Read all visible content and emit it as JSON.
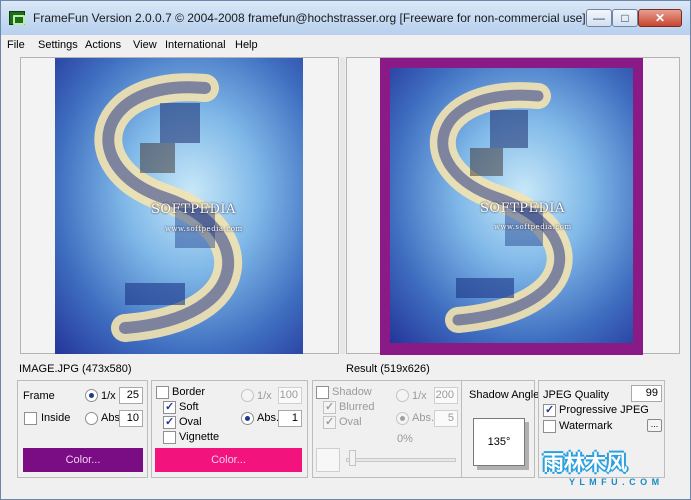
{
  "window": {
    "title": "FrameFun Version 2.0.0.7 © 2004-2008 framefun@hochstrasser.org [Freeware for non-commercial use]",
    "controls": {
      "minimize": "—",
      "maximize": "□",
      "close": "✕"
    }
  },
  "menu": [
    "File",
    "Settings",
    "Actions",
    "View",
    "International",
    "Help"
  ],
  "left_panel": {
    "art_title": "SOFTPEDIA",
    "art_sub": "www.softpedia.com",
    "caption": "IMAGE.JPG (473x580)"
  },
  "right_panel": {
    "art_title": "SOFTPEDIA",
    "art_sub": "www.softpedia.com",
    "caption": "Result (519x626)"
  },
  "frame_group": {
    "frame_label": "Frame",
    "inside_label": "Inside",
    "one_over_x_label": "1/x",
    "abs_label": "Abs.",
    "one_over_x_value": "25",
    "abs_value": "10",
    "color_button": "Color..."
  },
  "border_group": {
    "border_label": "Border",
    "soft_label": "Soft",
    "oval_label": "Oval",
    "vignette_label": "Vignette",
    "one_over_x_label": "1/x",
    "abs_label": "Abs.",
    "one_over_x_value": "100",
    "abs_value": "1",
    "color_button": "Color..."
  },
  "shadow_group": {
    "shadow_label": "Shadow",
    "blurred_label": "Blurred",
    "oval_label": "Oval",
    "one_over_x_label": "1/x",
    "abs_label": "Abs.",
    "one_over_x_value": "200",
    "abs_value": "5",
    "percent_label": "0%"
  },
  "angle_group": {
    "title": "Shadow Angle",
    "angle_value": "135°"
  },
  "jpeg_group": {
    "quality_label": "JPEG Quality",
    "quality_value": "99",
    "progressive_label": "Progressive JPEG",
    "watermark_label": "Watermark",
    "more_button": "..."
  },
  "site_watermark": {
    "title": "雨林木风",
    "url": "Y L M F U . C O M"
  },
  "colors": {
    "frame_color": "#7a0d84",
    "border_color": "#f3137c"
  }
}
